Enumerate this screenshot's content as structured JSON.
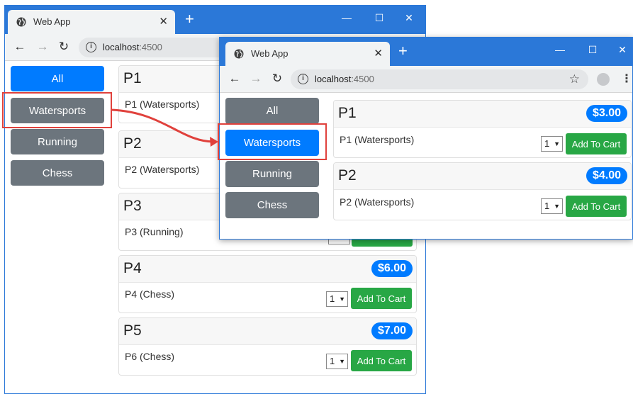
{
  "window_back": {
    "tab_title": "Web App",
    "tab_close": "✕",
    "new_tab": "+",
    "controls": [
      "—",
      "☐",
      "✕"
    ],
    "nav": {
      "back": "←",
      "forward": "→",
      "reload": "↻"
    },
    "address": {
      "host": "localhost",
      "port": ":4500"
    },
    "categories": [
      {
        "label": "All",
        "active": true
      },
      {
        "label": "Watersports",
        "active": false
      },
      {
        "label": "Running",
        "active": false
      },
      {
        "label": "Chess",
        "active": false
      }
    ],
    "products": [
      {
        "name": "P1",
        "price": "",
        "desc": "P1 (Watersports)",
        "qty": "",
        "add": ""
      },
      {
        "name": "P2",
        "price": "",
        "desc": "P2 (Watersports)",
        "qty": "",
        "add": ""
      },
      {
        "name": "P3",
        "price": "",
        "desc": "P3 (Running)",
        "qty": "",
        "add": ""
      },
      {
        "name": "P4",
        "price": "$6.00",
        "desc": "P4 (Chess)",
        "qty": "1",
        "add": "Add To Cart"
      },
      {
        "name": "P5",
        "price": "$7.00",
        "desc": "P6 (Chess)",
        "qty": "1",
        "add": "Add To Cart"
      }
    ]
  },
  "window_front": {
    "tab_title": "Web App",
    "tab_close": "✕",
    "new_tab": "+",
    "controls": [
      "—",
      "☐",
      "✕"
    ],
    "nav": {
      "back": "←",
      "forward": "→",
      "reload": "↻"
    },
    "address": {
      "host": "localhost",
      "port": ":4500"
    },
    "star": "☆",
    "menu": "⋮",
    "categories": [
      {
        "label": "All",
        "active": false
      },
      {
        "label": "Watersports",
        "active": true
      },
      {
        "label": "Running",
        "active": false
      },
      {
        "label": "Chess",
        "active": false
      }
    ],
    "products": [
      {
        "name": "P1",
        "price": "$3.00",
        "desc": "P1 (Watersports)",
        "qty": "1",
        "add": "Add To Cart"
      },
      {
        "name": "P2",
        "price": "$4.00",
        "desc": "P2 (Watersports)",
        "qty": "1",
        "add": "Add To Cart"
      }
    ]
  },
  "colors": {
    "titlebar": "#2b78d8",
    "primary": "#007bff",
    "secondary": "#6c757d",
    "success": "#28a745",
    "annotation": "#e0413c"
  }
}
